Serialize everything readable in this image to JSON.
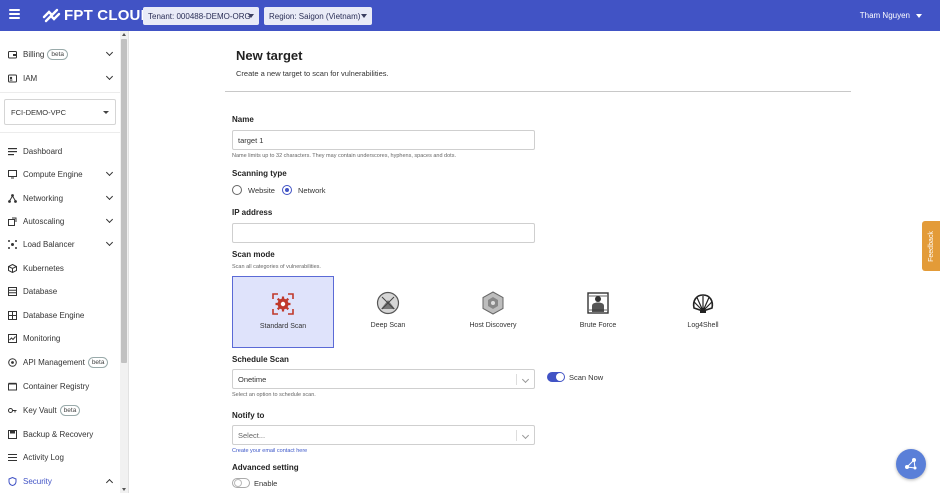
{
  "topbar": {
    "logo_text": "FPT CLOUD",
    "tenant_label": "Tenant: 000488-DEMO-ORG",
    "region_label": "Region: Saigon (Vietnam)",
    "user_name": "Tham Nguyen",
    "bg_color": "#4153c5"
  },
  "sidebar": {
    "billing": "Billing",
    "billing_badge": "beta",
    "iam": "IAM",
    "vpc": "FCI-DEMO-VPC",
    "items": [
      {
        "label": "Dashboard",
        "icon": "dashboard-icon"
      },
      {
        "label": "Compute Engine",
        "icon": "monitor-icon"
      },
      {
        "label": "Networking",
        "icon": "network-icon"
      },
      {
        "label": "Autoscaling",
        "icon": "autoscaling-icon"
      },
      {
        "label": "Load Balancer",
        "icon": "load-balancer-icon"
      },
      {
        "label": "Kubernetes",
        "icon": "cube-icon"
      },
      {
        "label": "Database",
        "icon": "database-icon"
      },
      {
        "label": "Database Engine",
        "icon": "database-engine-icon"
      },
      {
        "label": "Monitoring",
        "icon": "monitoring-icon"
      },
      {
        "label": "API Management",
        "icon": "api-icon",
        "badge": "beta"
      },
      {
        "label": "Container Registry",
        "icon": "container-icon"
      },
      {
        "label": "Key Vault",
        "icon": "key-icon",
        "badge": "beta"
      },
      {
        "label": "Backup & Recovery",
        "icon": "backup-icon"
      },
      {
        "label": "Activity Log",
        "icon": "list-icon"
      },
      {
        "label": "Security",
        "icon": "shield-icon"
      }
    ]
  },
  "page": {
    "title": "New target",
    "subtitle": "Create a new target to scan for vulnerabilities."
  },
  "form": {
    "name_label": "Name",
    "name_value": "target 1",
    "name_help": "Name limits up to 32 characters. They may contain underscores, hyphens, spaces and dots.",
    "scanning_type_label": "Scanning type",
    "scanning_type_options": [
      "Website",
      "Network"
    ],
    "scanning_type_selected": "Network",
    "ip_label": "IP address",
    "ip_value": "",
    "scan_mode_label": "Scan mode",
    "scan_mode_help": "Scan all categories of vulnerabilities.",
    "scan_modes": [
      "Standard Scan",
      "Deep Scan",
      "Host Discovery",
      "Brute Force",
      "Log4Shell"
    ],
    "scan_mode_selected": "Standard Scan",
    "schedule_label": "Schedule Scan",
    "schedule_value": "Onetime",
    "schedule_help": "Select an option to schedule scan.",
    "scan_now_label": "Scan Now",
    "scan_now_on": true,
    "notify_label": "Notify to",
    "notify_placeholder": "Select...",
    "notify_help": "Create your email contact here",
    "advanced_label": "Advanced setting",
    "enable_label": "Enable",
    "enable_on": false
  },
  "feedback_label": "Feedback",
  "colors": {
    "accent": "#4153c5",
    "selected_card_bg": "#dfe3fb",
    "feedback": "#e39b38"
  }
}
